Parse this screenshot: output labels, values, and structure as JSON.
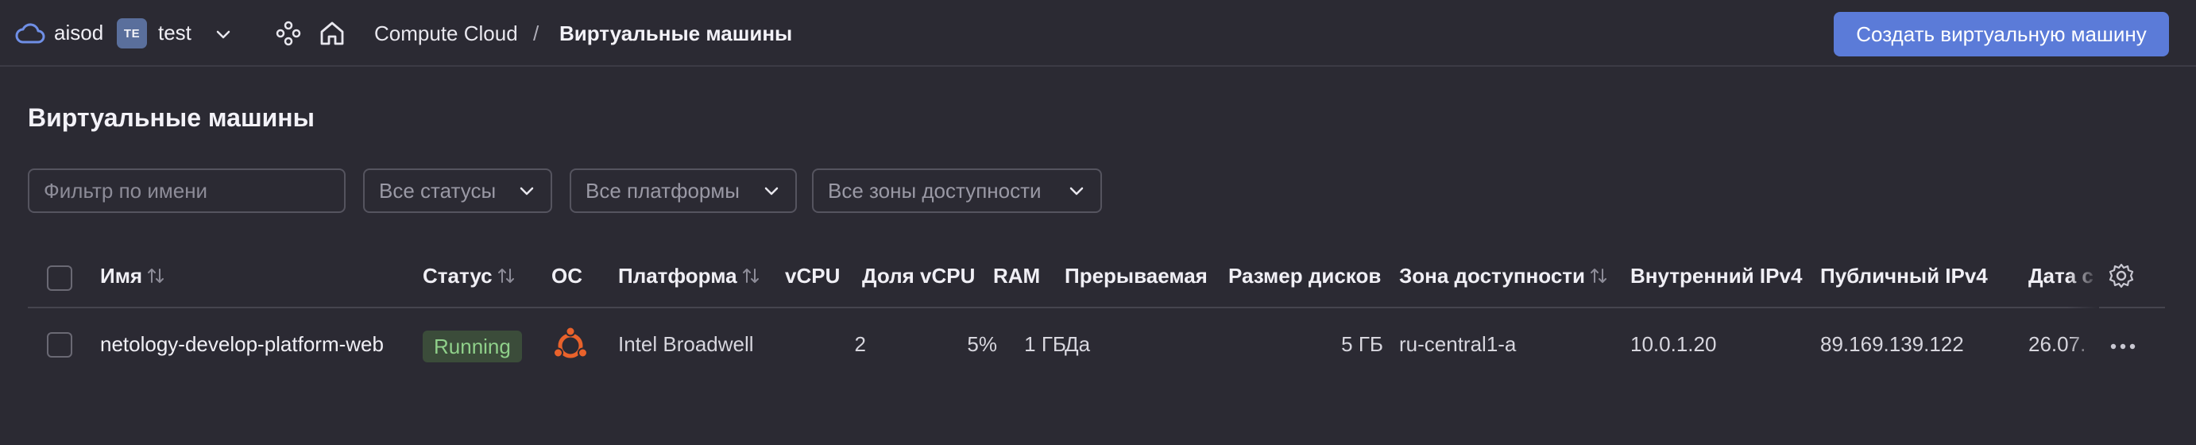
{
  "header": {
    "org_name": "aisod",
    "folder_badge": "TE",
    "folder_name": "test",
    "breadcrumb_service": "Compute Cloud",
    "breadcrumb_separator": "/",
    "breadcrumb_current": "Виртуальные машины",
    "create_button": "Создать виртуальную машину",
    "accent_color": "#5b7bd8"
  },
  "page": {
    "title": "Виртуальные машины"
  },
  "filters": {
    "name_placeholder": "Фильтр по имени",
    "status_select": "Все статусы",
    "platform_select": "Все платформы",
    "zone_select": "Все зоны доступности"
  },
  "table": {
    "columns": {
      "name": "Имя",
      "status": "Статус",
      "os": "ОС",
      "platform": "Платформа",
      "vcpu": "vCPU",
      "vcpu_share": "Доля vCPU",
      "ram": "RAM",
      "preemptible": "Прерываемая",
      "disk_size": "Размер дисков",
      "zone": "Зона доступности",
      "internal_ip": "Внутренний IPv4",
      "public_ip": "Публичный IPv4",
      "date": "Дата с"
    },
    "rows": [
      {
        "name": "netology-develop-platform-web",
        "status": "Running",
        "os_icon": "ubuntu-icon",
        "platform": "Intel Broadwell",
        "vcpu": "2",
        "vcpu_share": "5%",
        "ram": "1 ГБ",
        "preemptible": "Да",
        "disk_size": "5 ГБ",
        "zone": "ru-central1-a",
        "internal_ip": "10.0.1.20",
        "public_ip": "89.169.139.122",
        "date": "26.07."
      }
    ]
  },
  "colors": {
    "status_running_bg": "#3b4c3a",
    "status_running_text": "#8fd08a",
    "ubuntu_orange": "#e9622b"
  }
}
